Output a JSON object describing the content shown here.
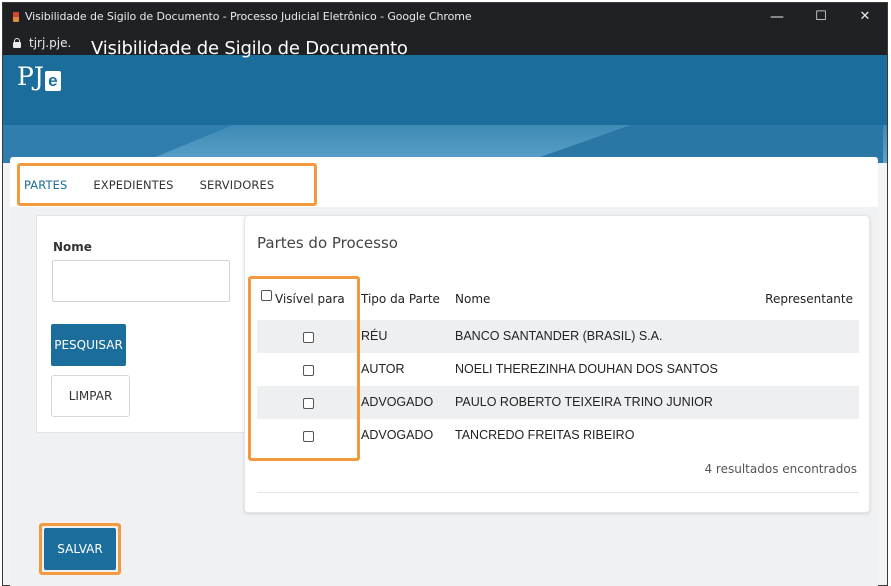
{
  "browser": {
    "title": "Visibilidade de Sigilo de Documento - Processo Judicial Eletrônico - Google Chrome",
    "url": "tjrj.pje.",
    "controls": {
      "minimize": "—",
      "maximize": "☐",
      "close": "✕"
    }
  },
  "app": {
    "logo_pj": "PJ",
    "logo_e": "e",
    "title": "Visibilidade de Sigilo de Documento"
  },
  "tabs": [
    {
      "label": "PARTES",
      "active": true
    },
    {
      "label": "EXPEDIENTES",
      "active": false
    },
    {
      "label": "SERVIDORES",
      "active": false
    }
  ],
  "search": {
    "label": "Nome",
    "value": "",
    "search_button": "PESQUISAR",
    "clear_button": "LIMPAR"
  },
  "results": {
    "title": "Partes do Processo",
    "columns": {
      "visible": "Visível para",
      "type": "Tipo da Parte",
      "name": "Nome",
      "representative": "Representante"
    },
    "rows": [
      {
        "type": "RÉU",
        "name": "BANCO SANTANDER (BRASIL) S.A.",
        "checked": false
      },
      {
        "type": "AUTOR",
        "name": "NOELI THEREZINHA DOUHAN DOS SANTOS",
        "checked": false
      },
      {
        "type": "ADVOGADO",
        "name": "PAULO ROBERTO TEIXEIRA TRINO JUNIOR",
        "checked": false
      },
      {
        "type": "ADVOGADO",
        "name": "TANCREDO FREITAS RIBEIRO",
        "checked": false
      }
    ],
    "count_text": "4 resultados encontrados"
  },
  "save_button": "SALVAR",
  "colors": {
    "brand": "#1b6e9b",
    "highlight": "#f39a3e"
  }
}
